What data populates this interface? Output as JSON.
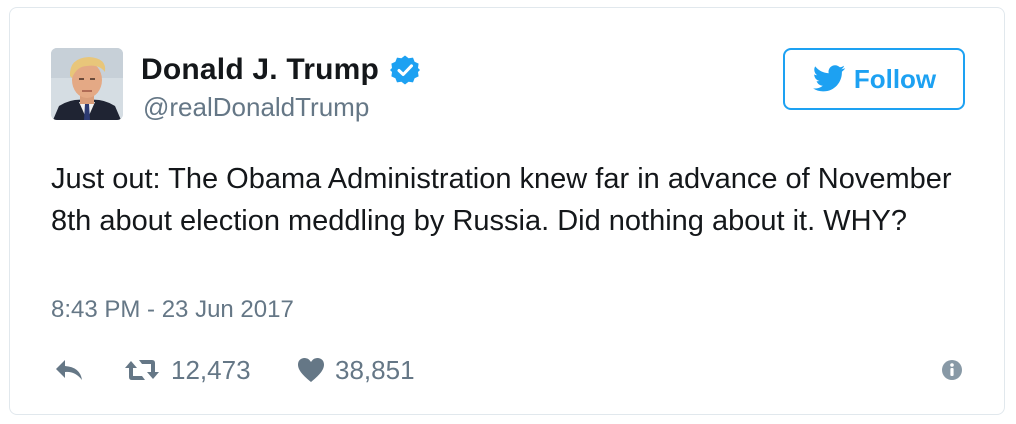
{
  "user": {
    "name": "Donald J. Trump",
    "handle": "@realDonaldTrump",
    "verified": true
  },
  "follow_button": {
    "label": "Follow"
  },
  "tweet": {
    "text": "Just out: The Obama Administration knew far in advance of November 8th about election meddling by Russia. Did nothing about it. WHY?",
    "timestamp": "8:43 PM - 23 Jun 2017"
  },
  "actions": {
    "retweet_count": "12,473",
    "like_count": "38,851"
  },
  "icons": {
    "verified": "verified-badge-icon",
    "bird": "twitter-bird-icon",
    "reply": "reply-arrow-icon",
    "retweet": "retweet-icon",
    "like": "heart-icon",
    "info": "info-icon"
  },
  "colors": {
    "accent": "#1da1f2",
    "text": "#14171a",
    "muted": "#657786",
    "border": "#e1e8ed"
  }
}
